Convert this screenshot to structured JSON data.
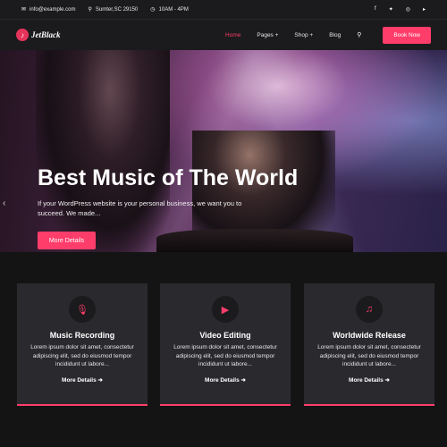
{
  "topbar": {
    "email": "info@example.com",
    "location": "Sumter,SC 29150",
    "hours": "10AM - 4PM",
    "email_icon": "envelope-icon",
    "location_icon": "map-pin-icon",
    "hours_icon": "clock-icon",
    "social": [
      "facebook-icon",
      "twitter-icon",
      "instagram-icon",
      "youtube-icon"
    ]
  },
  "header": {
    "logo_text": "JetBlack",
    "nav": [
      "Home",
      "Pages +",
      "Shop +",
      "Blog"
    ],
    "book_label": "Book Now"
  },
  "hero": {
    "title": "Best Music of The World",
    "subtitle": "If your WordPress website is your personal business, we want you to succeed. We made...",
    "button_label": "More Details"
  },
  "services": [
    {
      "icon": "microphone-icon",
      "title": "Music Recording",
      "text": "Lorem ipsum dolor sit amet, consectetur adipiscing elit, sed do eiusmod tempor incididunt ut labore...",
      "more": "More Details"
    },
    {
      "icon": "video-play-icon",
      "title": "Video Editing",
      "text": "Lorem ipsum dolor sit amet, consectetur adipiscing elit, sed do eiusmod tempor incididunt ut labore...",
      "more": "More Details"
    },
    {
      "icon": "music-note-icon",
      "title": "Worldwide Release",
      "text": "Lorem ipsum dolor sit amet, consectetur adipiscing elit, sed do eiusmod tempor incididunt ut labore...",
      "more": "More Details"
    }
  ],
  "colors": {
    "accent": "#ff3d6a",
    "header_bg": "#1b1b1d",
    "card_bg": "#2a2a2e"
  }
}
